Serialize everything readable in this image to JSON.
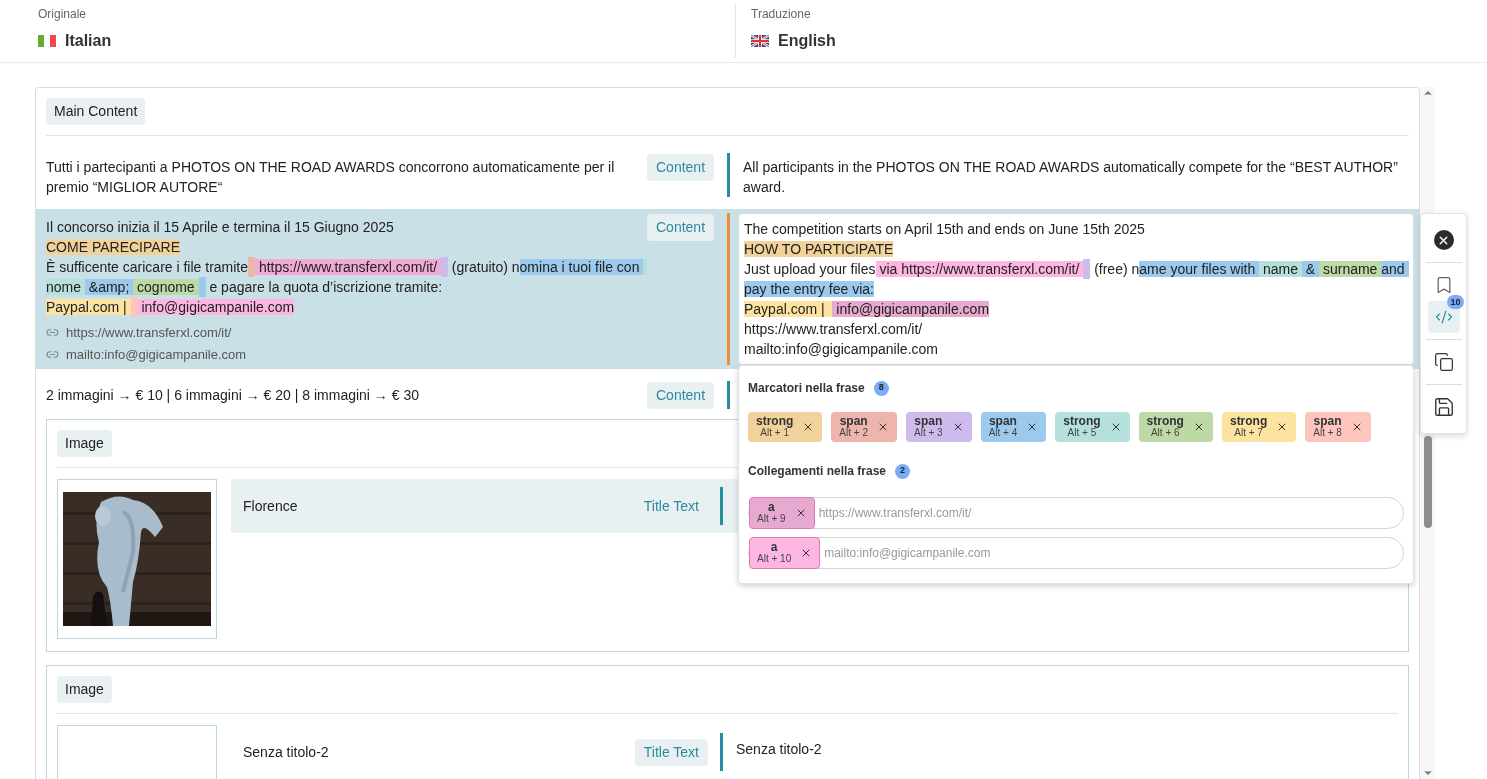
{
  "header": {
    "source": {
      "caption": "Originale",
      "language": "Italian"
    },
    "target": {
      "caption": "Traduzione",
      "language": "English"
    }
  },
  "section": {
    "label": "Main Content",
    "rows": [
      {
        "selected": false,
        "badge": "Content",
        "source": [
          [
            {
              "text": "Tutti i partecipanti a PHOTOS ON THE ROAD AWARDS concorrono automaticamente per il premio “MIGLIOR AUTORE“"
            }
          ]
        ],
        "target": [
          [
            {
              "text": "All participants in the PHOTOS ON THE ROAD AWARDS automatically compete for the “BEST AUTHOR” award."
            }
          ]
        ]
      },
      {
        "selected": true,
        "badge": "Content",
        "source": [
          [
            {
              "text": "Il concorso inizia il 15 Aprile e termina il 15 Giugno 2025"
            }
          ],
          [
            {
              "text": "COME PARECIPARE",
              "color": "#f2d29b"
            }
          ],
          [
            {
              "text": "È sufficente caricare i file tramite"
            },
            {
              "color": "#eeb5ad"
            },
            {
              "text": " https://www.transferxl.com/it/ ",
              "color": "#f0aad6"
            },
            {
              "color": "#cdbbec"
            },
            {
              "text": " (gratuito) n"
            },
            {
              "text": "omina i tuoi file con ",
              "color": "#9ccaee"
            },
            {
              "text": " nome ",
              "color": "#b6e0dc"
            },
            {
              "text": " &amp; ",
              "color": "#9ccaee"
            },
            {
              "text": " cognome ",
              "color": "#bdd9a5"
            },
            {
              "color": "#9ccaee"
            },
            {
              "text": " e pagare la quota d’iscrizione tramite:"
            }
          ],
          [
            {
              "text": "Paypal.com | ",
              "color": "#fde3a0"
            },
            {
              "color": "#fec5bd"
            },
            {
              "text": " info@gigicampanile.com",
              "color": "#fdb6e1"
            }
          ]
        ],
        "links": [
          "https://www.transferxl.com/it/",
          "mailto:info@gigicampanile.com"
        ],
        "target": [
          [
            {
              "text": "The competition starts on April 15th and ends on June 15th 2025"
            }
          ],
          [
            {
              "text": "HOW TO PARTICIPATE",
              "color": "#f2d29b"
            }
          ],
          [
            {
              "text": "Just upload your files"
            },
            {
              "text": " via https://www.transferxl.com/it/ ",
              "color": "#fdb6e1"
            },
            {
              "color": "#cdbbec"
            },
            {
              "text": " (free) n"
            },
            {
              "text": "ame your files with ",
              "color": "#9ccaee"
            },
            {
              "text": " name ",
              "color": "#b6e0dc"
            },
            {
              "text": " & ",
              "color": "#9ccaee"
            },
            {
              "text": " surname ",
              "color": "#bdd9a5"
            },
            {
              "text": "and pay the entry fee via:",
              "color": "#9ccaee"
            }
          ],
          [
            {
              "text": "Paypal.com |  ",
              "color": "#fde3a0"
            },
            {
              "text": " info@gigicampanile.com",
              "color": "#e8a9d1"
            }
          ],
          [
            {
              "text": "https://www.transferxl.com/it/"
            }
          ],
          [
            {
              "text": "mailto:info@gigicampanile.com"
            }
          ]
        ]
      },
      {
        "selected": false,
        "badge": "Content",
        "source": [
          [
            {
              "text": "2 immagini → € 10 | 6 immagini → € 20 | 8 immagini → € 30"
            }
          ]
        ]
      }
    ],
    "images": [
      {
        "label": "Image",
        "title": "Florence",
        "badge": "Title Text",
        "selected": true
      },
      {
        "label": "Image",
        "title": "Senza titolo-2",
        "badge": "Title Text",
        "selected": false,
        "translation": "Senza titolo-2"
      }
    ]
  },
  "markers_panel": {
    "markers_title": "Marcatori nella frase",
    "markers_count": "8",
    "markers": [
      {
        "tag": "strong",
        "shortcut": "Alt + 1",
        "color": "#f2d29b"
      },
      {
        "tag": "span",
        "shortcut": "Alt + 2",
        "color": "#eeb5ad"
      },
      {
        "tag": "span",
        "shortcut": "Alt + 3",
        "color": "#cdbbec"
      },
      {
        "tag": "span",
        "shortcut": "Alt + 4",
        "color": "#9ccaee"
      },
      {
        "tag": "strong",
        "shortcut": "Alt + 5",
        "color": "#b6e0dc"
      },
      {
        "tag": "strong",
        "shortcut": "Alt + 6",
        "color": "#bdd9a5"
      },
      {
        "tag": "strong",
        "shortcut": "Alt + 7",
        "color": "#fde3a0"
      },
      {
        "tag": "span",
        "shortcut": "Alt + 8",
        "color": "#fec5bd"
      }
    ],
    "links_title": "Collegamenti nella frase",
    "links_count": "2",
    "links": [
      {
        "tag": "a",
        "shortcut": "Alt + 9",
        "color": "#e8a9d1",
        "placeholder": "https://www.transferxl.com/it/"
      },
      {
        "tag": "a",
        "shortcut": "Alt + 10",
        "color": "#fdb6e1",
        "placeholder": "mailto:info@gigicampanile.com"
      }
    ]
  },
  "toolbar": [
    {
      "kind": "close",
      "selected": false
    },
    {
      "kind": "bookmark",
      "selected": false
    },
    {
      "kind": "code",
      "selected": true,
      "badge": "10"
    },
    {
      "kind": "copy",
      "selected": false
    },
    {
      "kind": "save",
      "selected": false
    }
  ]
}
